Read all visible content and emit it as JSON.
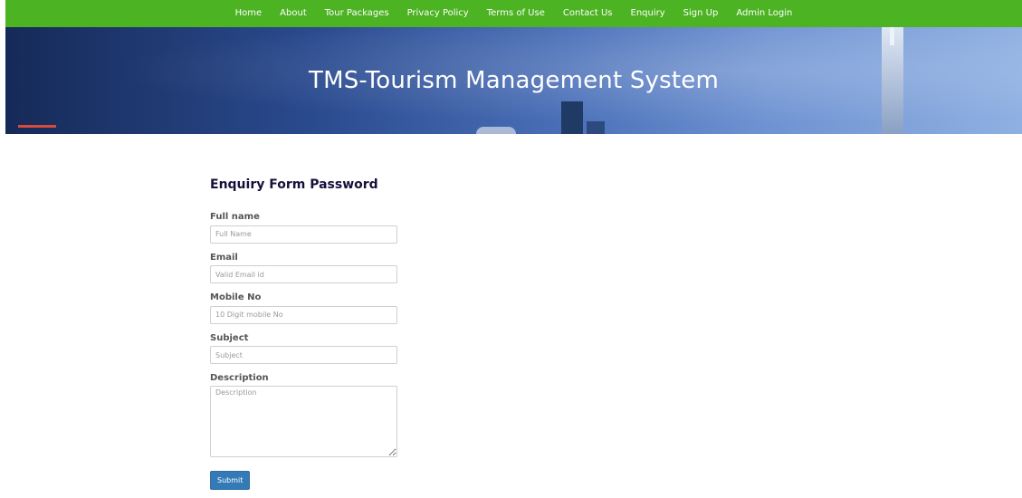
{
  "nav": {
    "items": [
      {
        "label": "Home"
      },
      {
        "label": "About"
      },
      {
        "label": "Tour Packages"
      },
      {
        "label": "Privacy Policy"
      },
      {
        "label": "Terms of Use"
      },
      {
        "label": "Contact Us"
      },
      {
        "label": "Enquiry"
      },
      {
        "label": "Sign Up"
      },
      {
        "label": "Admin Login"
      }
    ]
  },
  "banner": {
    "title": "TMS-Tourism Management System"
  },
  "form": {
    "title": "Enquiry Form Password",
    "fields": {
      "fullname": {
        "label": "Full name",
        "placeholder": "Full Name",
        "value": ""
      },
      "email": {
        "label": "Email",
        "placeholder": "Valid Email id",
        "value": ""
      },
      "mobile": {
        "label": "Mobile No",
        "placeholder": "10 Digit mobile No",
        "value": ""
      },
      "subject": {
        "label": "Subject",
        "placeholder": "Subject",
        "value": ""
      },
      "description": {
        "label": "Description",
        "placeholder": "Description",
        "value": ""
      }
    },
    "submit_label": "Submit"
  },
  "colors": {
    "nav_bg": "#4cb322",
    "submit_bg": "#337ab7",
    "title_color": "#16103a"
  }
}
